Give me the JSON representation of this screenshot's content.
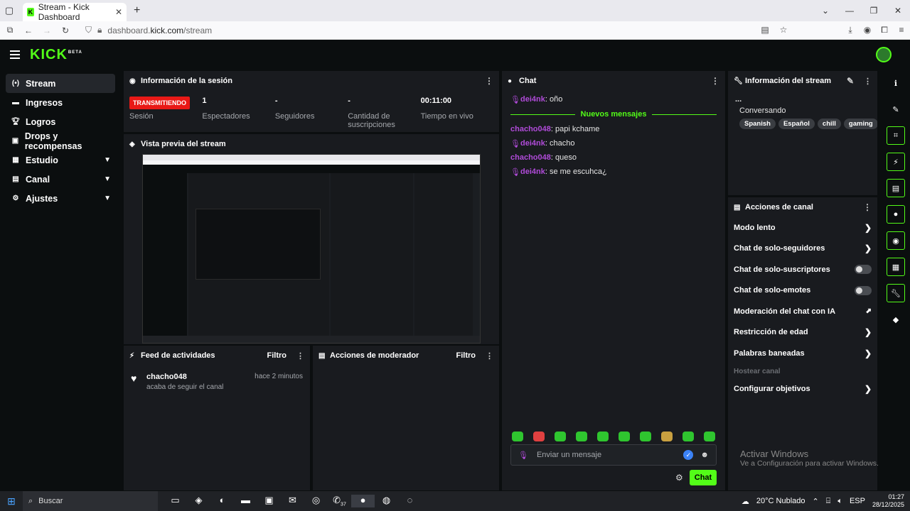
{
  "browser": {
    "tab_title": "Stream - Kick Dashboard",
    "url_prefix": "dashboard.",
    "url_host": "kick.com",
    "url_path": "/stream"
  },
  "header": {
    "logo": "KICK",
    "logo_badge": "BETA"
  },
  "sidebar": {
    "items": [
      {
        "label": "Stream",
        "icon": "broadcast-icon"
      },
      {
        "label": "Ingresos",
        "icon": "money-icon"
      },
      {
        "label": "Logros",
        "icon": "trophy-icon"
      },
      {
        "label": "Drops y recompensas",
        "icon": "gift-icon"
      },
      {
        "label": "Estudio",
        "icon": "studio-icon"
      },
      {
        "label": "Canal",
        "icon": "channel-icon"
      },
      {
        "label": "Ajustes",
        "icon": "gear-icon"
      }
    ]
  },
  "session": {
    "title": "Información de la sesión",
    "live_badge": "TRANSMITIENDO",
    "stats": [
      {
        "value": "",
        "label": "Sesión"
      },
      {
        "value": "1",
        "label": "Espectadores"
      },
      {
        "value": "-",
        "label": "Seguidores"
      },
      {
        "value": "-",
        "label": "Cantidad de suscripciones"
      },
      {
        "value": "00:11:00",
        "label": "Tiempo en vivo"
      }
    ]
  },
  "preview": {
    "title": "Vista previa del stream"
  },
  "feed": {
    "title": "Feed de actividades",
    "filter": "Filtro",
    "items": [
      {
        "user": "chacho048",
        "action": "acaba de seguir el canal",
        "time": "hace 2 minutos"
      }
    ]
  },
  "moderator": {
    "title": "Acciones de moderador",
    "filter": "Filtro"
  },
  "chat": {
    "title": "Chat",
    "new_messages": "Nuevos mensajes",
    "messages_before": [
      {
        "user": "dei4nk",
        "text": ": oño",
        "mic": true
      }
    ],
    "messages_after": [
      {
        "user": "chacho048",
        "text": ": papi kchame",
        "mic": false
      },
      {
        "user": "dei4nk",
        "text": ": chacho",
        "mic": true
      },
      {
        "user": "chacho048",
        "text": ": queso",
        "mic": false
      },
      {
        "user": "dei4nk",
        "text": ": se me escuhca¿",
        "mic": true
      }
    ],
    "input_placeholder": "Enviar un mensaje",
    "send_label": "Chat"
  },
  "stream_info": {
    "title": "Información del stream",
    "ellipsis": "...",
    "category": "Conversando",
    "tags": [
      "Spanish",
      "Español",
      "chill",
      "gaming"
    ]
  },
  "channel_actions": {
    "title": "Acciones de canal",
    "items": [
      {
        "label": "Modo lento",
        "control": "arrow"
      },
      {
        "label": "Chat de solo-seguidores",
        "control": "arrow"
      },
      {
        "label": "Chat de solo-suscriptores",
        "control": "toggle"
      },
      {
        "label": "Chat de solo-emotes",
        "control": "toggle"
      },
      {
        "label": "Moderación del chat con IA",
        "control": "chart"
      },
      {
        "label": "Restricción de edad",
        "control": "arrow"
      },
      {
        "label": "Palabras baneadas",
        "control": "arrow"
      },
      {
        "label": "Hostear canal",
        "control": "disabled"
      },
      {
        "label": "Configurar objetivos",
        "control": "arrow"
      }
    ]
  },
  "watermark": {
    "line1": "Activar Windows",
    "line2": "Ve a Configuración para activar Windows."
  },
  "taskbar": {
    "search": "Buscar",
    "weather": "20°C  Nublado",
    "lang": "ESP",
    "time": "01:27",
    "date": "28/12/2025",
    "whatsapp_badge": "37"
  },
  "colors": {
    "accent": "#53fc18",
    "live": "#e91916",
    "username": "#b04bd9"
  }
}
